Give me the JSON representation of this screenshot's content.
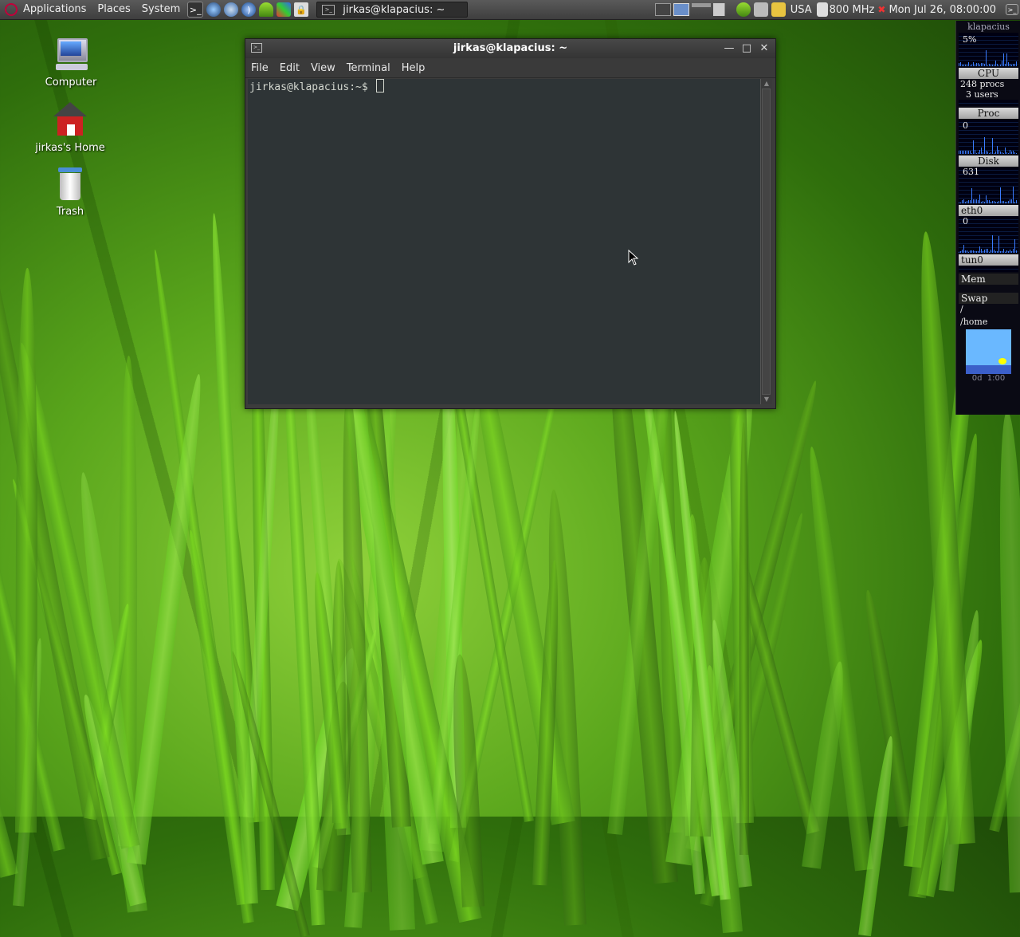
{
  "top_panel": {
    "menus": [
      "Applications",
      "Places",
      "System"
    ],
    "task_title": "jirkas@klapacius: ~",
    "keyboard_layout": "USA",
    "cpu_freq": "800 MHz",
    "clock": "Mon Jul 26, 08:00:00"
  },
  "desktop_icons": [
    {
      "label": "Computer",
      "icon": "computer-icon"
    },
    {
      "label": "jirkas's Home",
      "icon": "home-folder-icon"
    },
    {
      "label": "Trash",
      "icon": "trash-icon"
    }
  ],
  "terminal": {
    "title": "jirkas@klapacius: ~",
    "menus": [
      "File",
      "Edit",
      "View",
      "Terminal",
      "Help"
    ],
    "prompt": "jirkas@klapacius:~$ "
  },
  "gkrellm": {
    "hostname": "klapacius",
    "cpu_percent": "5%",
    "cpu_label": "CPU",
    "procs": "248 procs",
    "users": "3 users",
    "proc_label": "Proc",
    "proc_value": "0",
    "disk_label": "Disk",
    "disk_value": "631",
    "eth_label": "eth0",
    "eth_value": "0",
    "tun_label": "tun0",
    "mem_label": "Mem",
    "swap_label": "Swap",
    "fs_root": "/",
    "fs_home": "/home",
    "uptime": "0d  1:00"
  },
  "colors": {
    "panel": "#4a4a4a",
    "terminal_bg": "#2e3436",
    "terminal_fg": "#d3d7cf",
    "graph": "#3b7bff"
  }
}
